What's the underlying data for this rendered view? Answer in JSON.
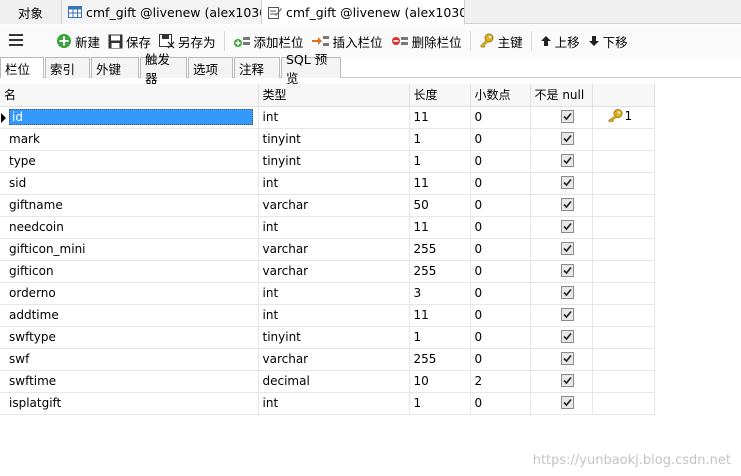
{
  "tabs": [
    {
      "label": "对象"
    },
    {
      "label": "cmf_gift @livenew (alex1030..."
    },
    {
      "label": "cmf_gift @livenew (alex1030..."
    }
  ],
  "toolbar": {
    "new": "新建",
    "save": "保存",
    "save_as": "另存为",
    "add_field": "添加栏位",
    "insert_field": "插入栏位",
    "delete_field": "删除栏位",
    "primary_key": "主键",
    "move_up": "上移",
    "move_down": "下移"
  },
  "subtabs": [
    "栏位",
    "索引",
    "外键",
    "触发器",
    "选项",
    "注释",
    "SQL 预览"
  ],
  "columns": {
    "name": "名",
    "type": "类型",
    "length": "长度",
    "decimals": "小数点",
    "not_null": "不是 null"
  },
  "fields": [
    {
      "name": "id",
      "type": "int",
      "length": "11",
      "decimals": "0",
      "not_null": true,
      "key": "1"
    },
    {
      "name": "mark",
      "type": "tinyint",
      "length": "1",
      "decimals": "0",
      "not_null": true
    },
    {
      "name": "type",
      "type": "tinyint",
      "length": "1",
      "decimals": "0",
      "not_null": true
    },
    {
      "name": "sid",
      "type": "int",
      "length": "11",
      "decimals": "0",
      "not_null": true
    },
    {
      "name": "giftname",
      "type": "varchar",
      "length": "50",
      "decimals": "0",
      "not_null": true
    },
    {
      "name": "needcoin",
      "type": "int",
      "length": "11",
      "decimals": "0",
      "not_null": true
    },
    {
      "name": "gifticon_mini",
      "type": "varchar",
      "length": "255",
      "decimals": "0",
      "not_null": true
    },
    {
      "name": "gifticon",
      "type": "varchar",
      "length": "255",
      "decimals": "0",
      "not_null": true
    },
    {
      "name": "orderno",
      "type": "int",
      "length": "3",
      "decimals": "0",
      "not_null": true
    },
    {
      "name": "addtime",
      "type": "int",
      "length": "11",
      "decimals": "0",
      "not_null": true
    },
    {
      "name": "swftype",
      "type": "tinyint",
      "length": "1",
      "decimals": "0",
      "not_null": true
    },
    {
      "name": "swf",
      "type": "varchar",
      "length": "255",
      "decimals": "0",
      "not_null": true
    },
    {
      "name": "swftime",
      "type": "decimal",
      "length": "10",
      "decimals": "2",
      "not_null": true
    },
    {
      "name": "isplatgift",
      "type": "int",
      "length": "1",
      "decimals": "0",
      "not_null": true
    }
  ],
  "watermark": "https://yunbaokj.blog.csdn.net",
  "colors": {
    "selection": "#3399ff",
    "key": "#e0b020"
  },
  "icons": [
    "table-icon",
    "design-icon",
    "menu-icon",
    "new-icon",
    "save-icon",
    "save-as-icon",
    "add-field-icon",
    "insert-field-icon",
    "delete-field-icon",
    "key-icon",
    "arrow-up-icon",
    "arrow-down-icon",
    "checkbox-checked-icon"
  ]
}
